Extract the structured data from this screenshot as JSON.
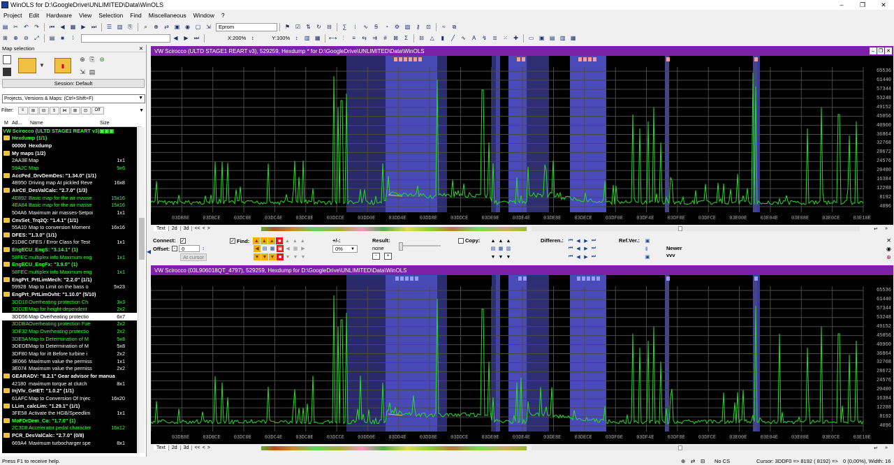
{
  "window": {
    "title": "WinOLS for D:\\GoogleDrive\\UNLIMITED\\Data\\WinOLS",
    "minimize": "–",
    "maximize": "❐",
    "close": "✕"
  },
  "menu": [
    "Project",
    "Edit",
    "Hardware",
    "View",
    "Selection",
    "Find",
    "Miscellaneous",
    "Window",
    "?"
  ],
  "toolbar": {
    "eprom": "Eprom",
    "xzoom": "X:200%",
    "yzoom": "Y:100%"
  },
  "left_panel": {
    "title": "Map selection",
    "session": "Session: Default",
    "project_select": "Projects, Versions & Maps:  (Ctrl+Shift+F)",
    "filter_label": "Filter:",
    "filter_off": "Off",
    "columns": [
      "M",
      "Ad...",
      "Name",
      "Size"
    ],
    "rows": [
      {
        "t": "root",
        "name": "VW Scirocco (ULTD STAGE1 REART v3)"
      },
      {
        "t": "folder",
        "g": true,
        "name": "Hexdump (1/1)"
      },
      {
        "t": "item",
        "addr": "00000",
        "name": "Hexdump",
        "size": "",
        "bold": true
      },
      {
        "t": "folder",
        "name": "My maps (1/2)"
      },
      {
        "t": "item",
        "addr": "2AA3E",
        "name": "Map",
        "size": "1x1"
      },
      {
        "t": "item",
        "g": true,
        "addr": "59A2C",
        "name": "Map",
        "size": "5x6"
      },
      {
        "t": "folder",
        "name": "AccPed_DrvDemDes: \"1.34.0\" (1/1)"
      },
      {
        "t": "item",
        "addr": "4B950",
        "name": "Driving map At pickled Reve",
        "size": "16x8"
      },
      {
        "t": "folder",
        "name": "AirCtl_DesValCalc: \"2.7.0\" (1/3)"
      },
      {
        "t": "item",
        "g": true,
        "addr": "4E892",
        "name": "Basic map for the air masse",
        "size": "15x16"
      },
      {
        "t": "item",
        "g": true,
        "addr": "4EA84",
        "name": "Basic map for the air masse",
        "size": "15x16"
      },
      {
        "t": "item",
        "addr": "504A6",
        "name": "Maximum air masses-Setpoi",
        "size": "1x1"
      },
      {
        "t": "folder",
        "name": "CnvSet_Trq2Q: \"1.4.1\" (1/1)"
      },
      {
        "t": "item",
        "addr": "55A10",
        "name": "Map to conversion Moment",
        "size": "16x16"
      },
      {
        "t": "folder",
        "name": "DFES: \"1.3.0\" (1/1)"
      },
      {
        "t": "item",
        "addr": "21D8C",
        "name": "DFES / Error Class for Test",
        "size": "1x1"
      },
      {
        "t": "folder",
        "g": true,
        "name": "EngECU_EngS: \"3.14.1\" (1)"
      },
      {
        "t": "item",
        "g": true,
        "addr": "58FEC",
        "name": "multiplex info Maximum eng",
        "size": "1x1"
      },
      {
        "t": "folder",
        "g": true,
        "name": "EngECU_EngFx: \"3.9.0\" (1)"
      },
      {
        "t": "item",
        "g": true,
        "addr": "58FEC",
        "name": "multiplex info Maximum eng",
        "size": "1x1"
      },
      {
        "t": "folder",
        "name": "EngPrt_PrtLimMech: \"2.2.0\" (1/1)"
      },
      {
        "t": "item",
        "addr": "59928",
        "name": "Map to Limit on the bass o",
        "size": "5x23"
      },
      {
        "t": "folder",
        "name": "EngPrt_PrtLimOvht: \"1.10.0\" (5/10)"
      },
      {
        "t": "item",
        "g": true,
        "addr": "3DD10",
        "name": "Overheating protection Ch",
        "size": "3x3"
      },
      {
        "t": "item",
        "g": true,
        "addr": "3DD2E",
        "name": "Map for height-dependent",
        "size": "2x2"
      },
      {
        "t": "item",
        "sel": true,
        "addr": "3DD56",
        "name": "Map Overheating protectio",
        "size": "6x7"
      },
      {
        "t": "item",
        "g": true,
        "addr": "3DDBA",
        "name": "Overheating protection Fue",
        "size": "2x2"
      },
      {
        "t": "item",
        "g": true,
        "addr": "3DE32",
        "name": "Map Overheating protectio",
        "size": "2x2"
      },
      {
        "t": "item",
        "g": true,
        "addr": "3DE5A",
        "name": "Map to Determination of M",
        "size": "5x8"
      },
      {
        "t": "item",
        "addr": "3DEDE",
        "name": "Map to Determination of M",
        "size": "5x8"
      },
      {
        "t": "item",
        "addr": "3DF80",
        "name": "Map for itt Before turbine i",
        "size": "2x2"
      },
      {
        "t": "item",
        "addr": "3E066",
        "name": "Maximum value the permiss",
        "size": "1x1"
      },
      {
        "t": "item",
        "addr": "3E074",
        "name": "Maximum value the permiss",
        "size": "2x2"
      },
      {
        "t": "folder",
        "name": "GEARADV: \"8.2.1\"   Gear advisor for manua"
      },
      {
        "t": "item",
        "addr": "42180",
        "name": "maximum torque at clutch",
        "size": "8x1"
      },
      {
        "t": "folder",
        "name": "InjVlv_GetET: \"1.0.2\" (1/1)"
      },
      {
        "t": "item",
        "addr": "61AFC",
        "name": "Map to Conversion Of Injec",
        "size": "16x20"
      },
      {
        "t": "folder",
        "name": "LLim_calcLim: \"1.29.1\" (1/1)"
      },
      {
        "t": "item",
        "addr": "3FE58",
        "name": "Activate the HGB/Speedlim",
        "size": "1x1"
      },
      {
        "t": "folder",
        "g": true,
        "name": "MoFDrDem_Co: \"1.7.0\" (1)"
      },
      {
        "t": "item",
        "g": true,
        "addr": "2C3D8",
        "name": "Accelerator pedal character",
        "size": "16x12"
      },
      {
        "t": "folder",
        "name": "PCR_DesValCalc: \"2.7.0\" (0/8)"
      },
      {
        "t": "item",
        "addr": "669A4",
        "name": "Maximum turbocharger spe",
        "size": "8x1"
      }
    ]
  },
  "top_pane": {
    "title": "VW Scirocco (ULTD STAGE1 REART v3), 529259, Hexdump * for D:\\GoogleDrive\\UNLIMITED\\Data\\WinOLS",
    "tabs": [
      "Text",
      "2d",
      "3d"
    ]
  },
  "bottom_pane": {
    "title": "VW Scirocco (03L906018QT_4797), 529259, Hexdump for D:\\GoogleDrive\\UNLIMITED\\Data\\WinOLS",
    "tabs": [
      "Text",
      "2d",
      "3d"
    ]
  },
  "x_ticks": [
    "03DB8E",
    "03DBCE",
    "03DC0E",
    "03DC4E",
    "03DC8E",
    "03DCCE",
    "03DD0E",
    "03DD4E",
    "03DD8E",
    "03DDCE",
    "03DE0E",
    "03DE4E",
    "03DE8E",
    "03DECE",
    "03DF0E",
    "03DF4E",
    "03DF8E",
    "03DFCE",
    "03E00E",
    "03E04E",
    "03E08E",
    "03E0CE",
    "03E10E"
  ],
  "y_ticks": [
    "65536",
    "61440",
    "57344",
    "53248",
    "49152",
    "45056",
    "40960",
    "36864",
    "32768",
    "28672",
    "24576",
    "20480",
    "16384",
    "12288",
    "8192",
    "4096"
  ],
  "control_panel": {
    "connect": "Connect:",
    "offset": "Offset:",
    "offset_value": "0",
    "at_cursor": "At cursor",
    "find": "Find:",
    "plusminus": "+/-:",
    "percent": "0%",
    "result": "Result:",
    "result_value": "none",
    "copy": "Copy:",
    "differences": "Differen.:",
    "refver": "Ref.Ver.:",
    "newer": "Newer",
    "vvv": "vvv"
  },
  "status": {
    "help": "Press F1 to receive help.",
    "nocs": "No CS",
    "cursor": "Cursor: 3DDF0 =>    8192 ( 8192) =>",
    "zero": "0 (0,00%), Width: 16"
  },
  "colors": {
    "pane_header": "#7d1fa7",
    "grid": "#4a4a4a",
    "trace": "#22dd22",
    "highlight": "#4444b8",
    "marker": "#ff9999"
  }
}
